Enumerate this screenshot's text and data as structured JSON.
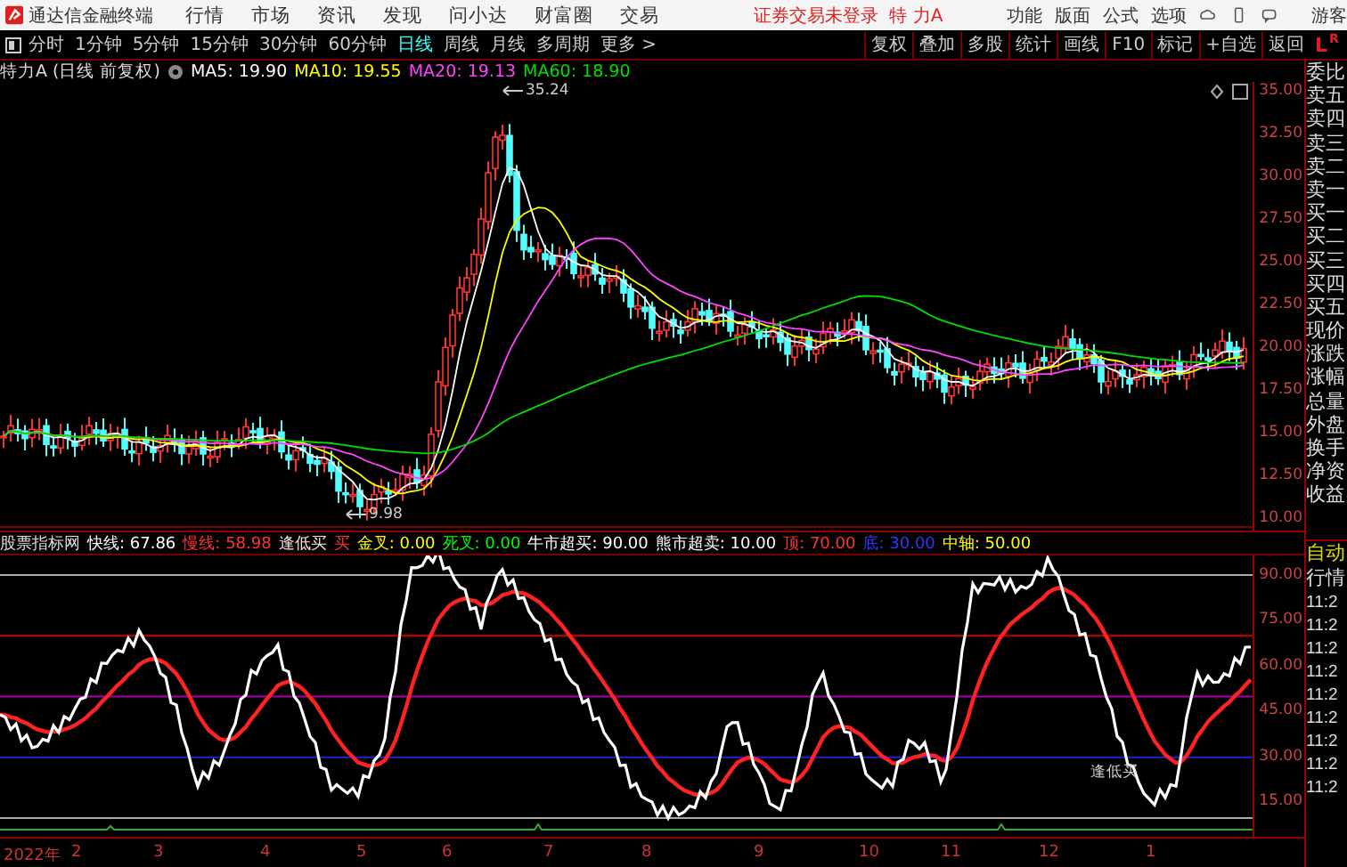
{
  "menu_bar": {
    "app_title": "通达信金融终端",
    "menus": [
      "行情",
      "市场",
      "资讯",
      "发现",
      "问小达",
      "财富圈",
      "交易"
    ],
    "status": [
      "证券交易未登录",
      "特 力A"
    ],
    "actions": [
      "功能",
      "版面",
      "公式",
      "选项"
    ],
    "user": "游客"
  },
  "toolbar": {
    "periods": [
      {
        "label": "分时",
        "selected": false
      },
      {
        "label": "1分钟",
        "selected": false
      },
      {
        "label": "5分钟",
        "selected": false
      },
      {
        "label": "15分钟",
        "selected": false
      },
      {
        "label": "30分钟",
        "selected": false
      },
      {
        "label": "60分钟",
        "selected": false
      },
      {
        "label": "日线",
        "selected": true
      },
      {
        "label": "周线",
        "selected": false
      },
      {
        "label": "月线",
        "selected": false
      },
      {
        "label": "多周期",
        "selected": false
      },
      {
        "label": "更多 >",
        "selected": false
      }
    ],
    "tools": [
      "复权",
      "叠加",
      "多股",
      "统计",
      "画线",
      "F10",
      "标记",
      "+自选",
      "返回"
    ],
    "corner_badge": {
      "letter": "L",
      "sub": "R"
    }
  },
  "price_chart": {
    "title": "特力A (日线 前复权)",
    "moving_averages": [
      {
        "label": "MA5: 19.90",
        "color": "#ffffff"
      },
      {
        "label": "MA10: 19.55",
        "color": "#ffff00"
      },
      {
        "label": "MA20: 19.13",
        "color": "#ff44ff"
      },
      {
        "label": "MA60: 18.90",
        "color": "#00dd00"
      }
    ],
    "y_axis": [
      "35.00",
      "32.50",
      "30.00",
      "27.50",
      "25.00",
      "22.50",
      "20.00",
      "17.50",
      "15.00",
      "12.50",
      "10.00"
    ],
    "high_label": "35.24",
    "low_label": "9.98"
  },
  "indicator": {
    "name": "股票指标网",
    "values": [
      {
        "label": "快线: 67.86",
        "color": "#ffffff"
      },
      {
        "label": "慢线: 58.98",
        "color": "#ff3333"
      },
      {
        "label": "逢低买",
        "color": "#ffdddd"
      },
      {
        "label": "买",
        "color": "#ff3333"
      },
      {
        "label": "金叉: 0.00",
        "color": "#ffff00"
      },
      {
        "label": "死叉: 0.00",
        "color": "#00ff00"
      },
      {
        "label": "牛市超买: 90.00",
        "color": "#ffffff"
      },
      {
        "label": "熊市超卖: 10.00",
        "color": "#ffffff"
      },
      {
        "label": "顶: 70.00",
        "color": "#ff3333"
      },
      {
        "label": "底: 30.00",
        "color": "#3333ff"
      },
      {
        "label": "中轴: 50.00",
        "color": "#ffff00"
      }
    ],
    "y_axis": [
      "90.00",
      "75.00",
      "60.00",
      "45.00",
      "30.00",
      "15.00"
    ],
    "signal_label": "逢低买"
  },
  "date_axis": [
    "2022年",
    "2",
    "3",
    "4",
    "5",
    "6",
    "7",
    "8",
    "9",
    "10",
    "11",
    "12",
    "1"
  ],
  "quote_panel": {
    "fields": [
      "委比",
      "卖五",
      "卖四",
      "卖三",
      "卖二",
      "卖一",
      "买一",
      "买二",
      "买三",
      "买四",
      "买五",
      "现价",
      "涨跌",
      "涨幅",
      "总量",
      "外盘",
      "换手",
      "净资",
      "收益"
    ],
    "mode": "自动",
    "tab": "行情",
    "times": [
      "11:2",
      "11:2",
      "11:2",
      "11:2",
      "11:2",
      "11:2",
      "11:2",
      "11:2",
      "11:2"
    ]
  }
}
